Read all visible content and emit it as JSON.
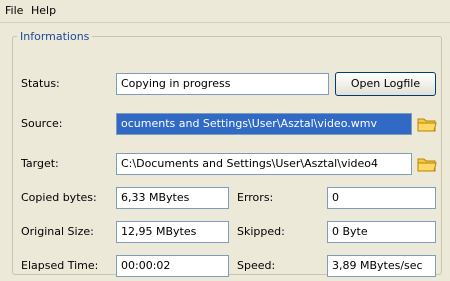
{
  "menu": {
    "file": "File",
    "help": "Help"
  },
  "group_title": "Informations",
  "status": {
    "label": "Status:",
    "value": "Copying in progress",
    "open_log_button": "Open Logfile"
  },
  "source": {
    "label": "Source:",
    "value": "ocuments and Settings\\User\\Asztal\\video.wmv"
  },
  "target": {
    "label": "Target:",
    "value": "C:\\Documents and Settings\\User\\Asztal\\video4"
  },
  "copied": {
    "label": "Copied bytes:",
    "value": "6,33 MBytes"
  },
  "errors": {
    "label": "Errors:",
    "value": "0"
  },
  "original": {
    "label": "Original Size:",
    "value": "12,95 MBytes"
  },
  "skipped": {
    "label": "Skipped:",
    "value": "0 Byte"
  },
  "elapsed": {
    "label": "Elapsed Time:",
    "value": "00:00:02"
  },
  "speed": {
    "label": "Speed:",
    "value": "3,89 MBytes/sec"
  },
  "icons": {
    "folder": "folder-icon"
  },
  "colors": {
    "selection": "#316ac5",
    "group_title": "#1a4a9a",
    "window_bg": "#ece9d8"
  }
}
